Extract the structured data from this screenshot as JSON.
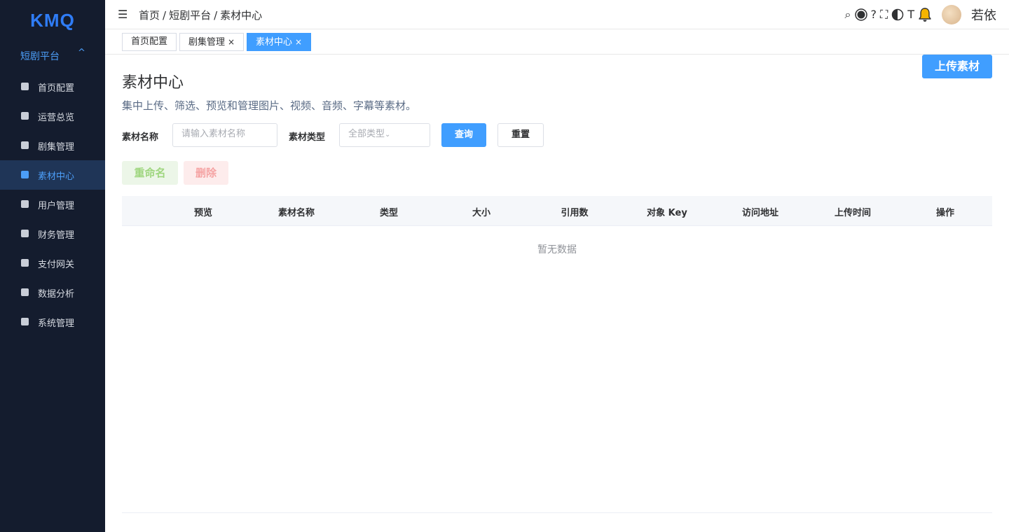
{
  "sidebar": {
    "logo": "KMQ",
    "group": {
      "label": "短剧平台",
      "caret": "^"
    },
    "items": [
      {
        "label": "首页配置"
      },
      {
        "label": "运营总览"
      },
      {
        "label": "剧集管理"
      },
      {
        "label": "素材中心",
        "active": true
      },
      {
        "label": "用户管理"
      },
      {
        "label": "财务管理"
      },
      {
        "label": "支付网关"
      },
      {
        "label": "数据分析"
      },
      {
        "label": "系统管理"
      }
    ]
  },
  "header": {
    "breadcrumb": [
      "首页",
      "短剧平台",
      "素材中心"
    ],
    "breadcrumb_sep": "/",
    "tools": {
      "search": "⌕",
      "help": "?",
      "fullscreen": "⛶",
      "font": "T"
    },
    "username": "若依"
  },
  "tags": [
    {
      "label": "首页配置",
      "closable": false
    },
    {
      "label": "剧集管理",
      "closable": true
    },
    {
      "label": "素材中心",
      "closable": true,
      "active": true
    }
  ],
  "tag_close": "×",
  "page": {
    "title": "素材中心",
    "description": "集中上传、筛选、预览和管理图片、视频、音频、字幕等素材。",
    "upload_label": "上传素材"
  },
  "filters": {
    "name_label": "素材名称",
    "name_placeholder": "请输入素材名称",
    "type_label": "素材类型",
    "type_value": "全部类型",
    "query_label": "查询",
    "reset_label": "重置"
  },
  "actions": {
    "rename_label": "重命名",
    "delete_label": "删除"
  },
  "table": {
    "columns": [
      "预览",
      "素材名称",
      "类型",
      "大小",
      "引用数",
      "对象 Key",
      "访问地址",
      "上传时间",
      "操作"
    ],
    "empty_text": "暂无数据"
  },
  "colors": {
    "primary": "#409eff",
    "sidebar_bg": "#141c2e",
    "active_text": "#4c9ef8"
  }
}
